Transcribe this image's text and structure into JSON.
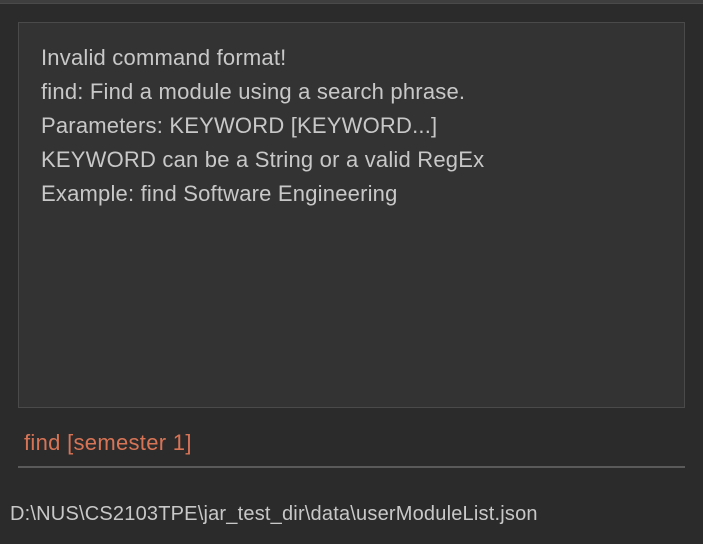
{
  "output": {
    "lines": [
      "Invalid command format!",
      "find: Find a module using a search phrase.",
      "Parameters: KEYWORD [KEYWORD...]",
      "KEYWORD can be a String or a valid RegEx",
      "Example: find Software Engineering"
    ]
  },
  "command": {
    "text": "find [semester 1]"
  },
  "status": {
    "path": "D:\\NUS\\CS2103TPE\\jar_test_dir\\data\\userModuleList.json"
  }
}
